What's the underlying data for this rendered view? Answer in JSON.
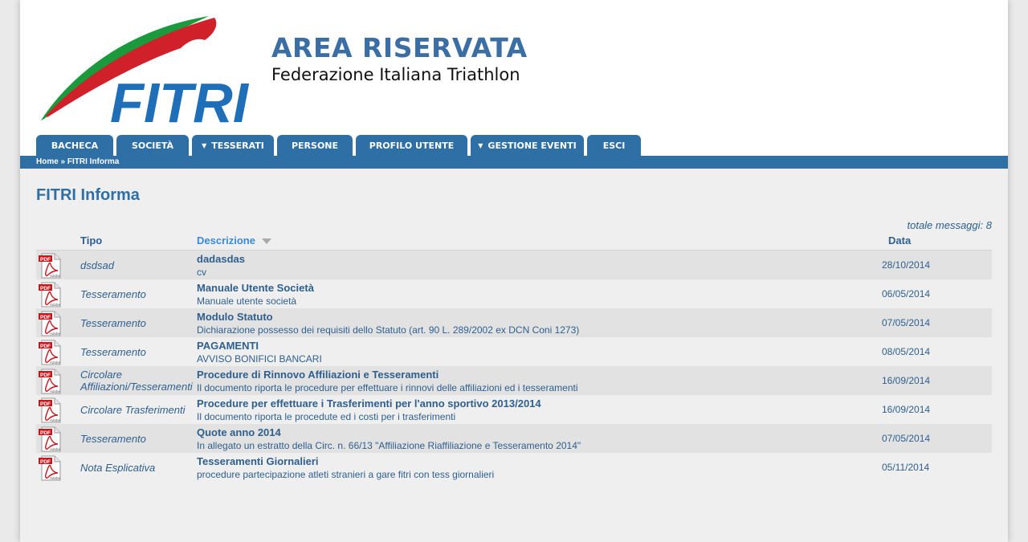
{
  "header": {
    "logo_text": "FITRI",
    "title": "AREA RISERVATA",
    "subtitle": "Federazione Italiana Triathlon"
  },
  "nav": {
    "tabs": [
      {
        "label": "BACHECA",
        "has_dropdown": false
      },
      {
        "label": "SOCIETÀ",
        "has_dropdown": false
      },
      {
        "label": "TESSERATI",
        "has_dropdown": true
      },
      {
        "label": "PERSONE",
        "has_dropdown": false
      },
      {
        "label": "PROFILO UTENTE",
        "has_dropdown": false
      },
      {
        "label": "GESTIONE EVENTI",
        "has_dropdown": true
      },
      {
        "label": "ESCI",
        "has_dropdown": false
      }
    ],
    "dropdown_glyph": "▼"
  },
  "breadcrumb": "Home » FITRI Informa",
  "main": {
    "title": "FITRI Informa",
    "total_messages": "totale messaggi: 8",
    "columns": {
      "tipo": "Tipo",
      "descrizione": "Descrizione",
      "data": "Data"
    },
    "sort_icon": "sort-desc-icon",
    "pdf_icon": "pdf-icon",
    "pdf_label": "PDF",
    "pdf_brand": "Adobe",
    "rows": [
      {
        "tipo": "dsdsad",
        "title": "dadasdas",
        "subtitle": "cv",
        "date": "28/10/2014"
      },
      {
        "tipo": "Tesseramento",
        "title": "Manuale Utente Società",
        "subtitle": "Manuale utente società",
        "date": "06/05/2014"
      },
      {
        "tipo": "Tesseramento",
        "title": "Modulo Statuto",
        "subtitle": "Dichiarazione possesso dei requisiti dello Statuto (art. 90 L. 289/2002 ex DCN Coni 1273)",
        "date": "07/05/2014"
      },
      {
        "tipo": "Tesseramento",
        "title": "PAGAMENTI",
        "subtitle": "AVVISO BONIFICI BANCARI",
        "date": "08/05/2014"
      },
      {
        "tipo": "Circolare Affiliazioni/Tesseramenti",
        "title": "Procedure di Rinnovo Affiliazioni e Tesseramenti",
        "subtitle": "Il documento riporta le procedure per effettuare i rinnovi delle affiliazioni ed i tesseramenti",
        "date": "16/09/2014"
      },
      {
        "tipo": "Circolare Trasferimenti",
        "title": "Procedure per effettuare i Trasferimenti per l'anno sportivo 2013/2014",
        "subtitle": "Il documento riporta le procedute ed i costi per i trasferimenti",
        "date": "16/09/2014"
      },
      {
        "tipo": "Tesseramento",
        "title": "Quote anno 2014",
        "subtitle": "In allegato un estratto della Circ. n. 66/13 \"Affiliazione Riaffiliazione e Tesseramento 2014\"",
        "date": "07/05/2014"
      },
      {
        "tipo": "Nota Esplicativa",
        "title": "Tesseramenti Giornalieri",
        "subtitle": "procedure partecipazione atleti stranieri a gare fitri con tess giornalieri",
        "date": "05/11/2014"
      }
    ]
  },
  "colors": {
    "brand_blue": "#2e6fa6",
    "logo_blue": "#1e6fb8",
    "logo_green": "#1a9a3c",
    "logo_red": "#d0202a",
    "text_blue": "#2e5f8f"
  }
}
